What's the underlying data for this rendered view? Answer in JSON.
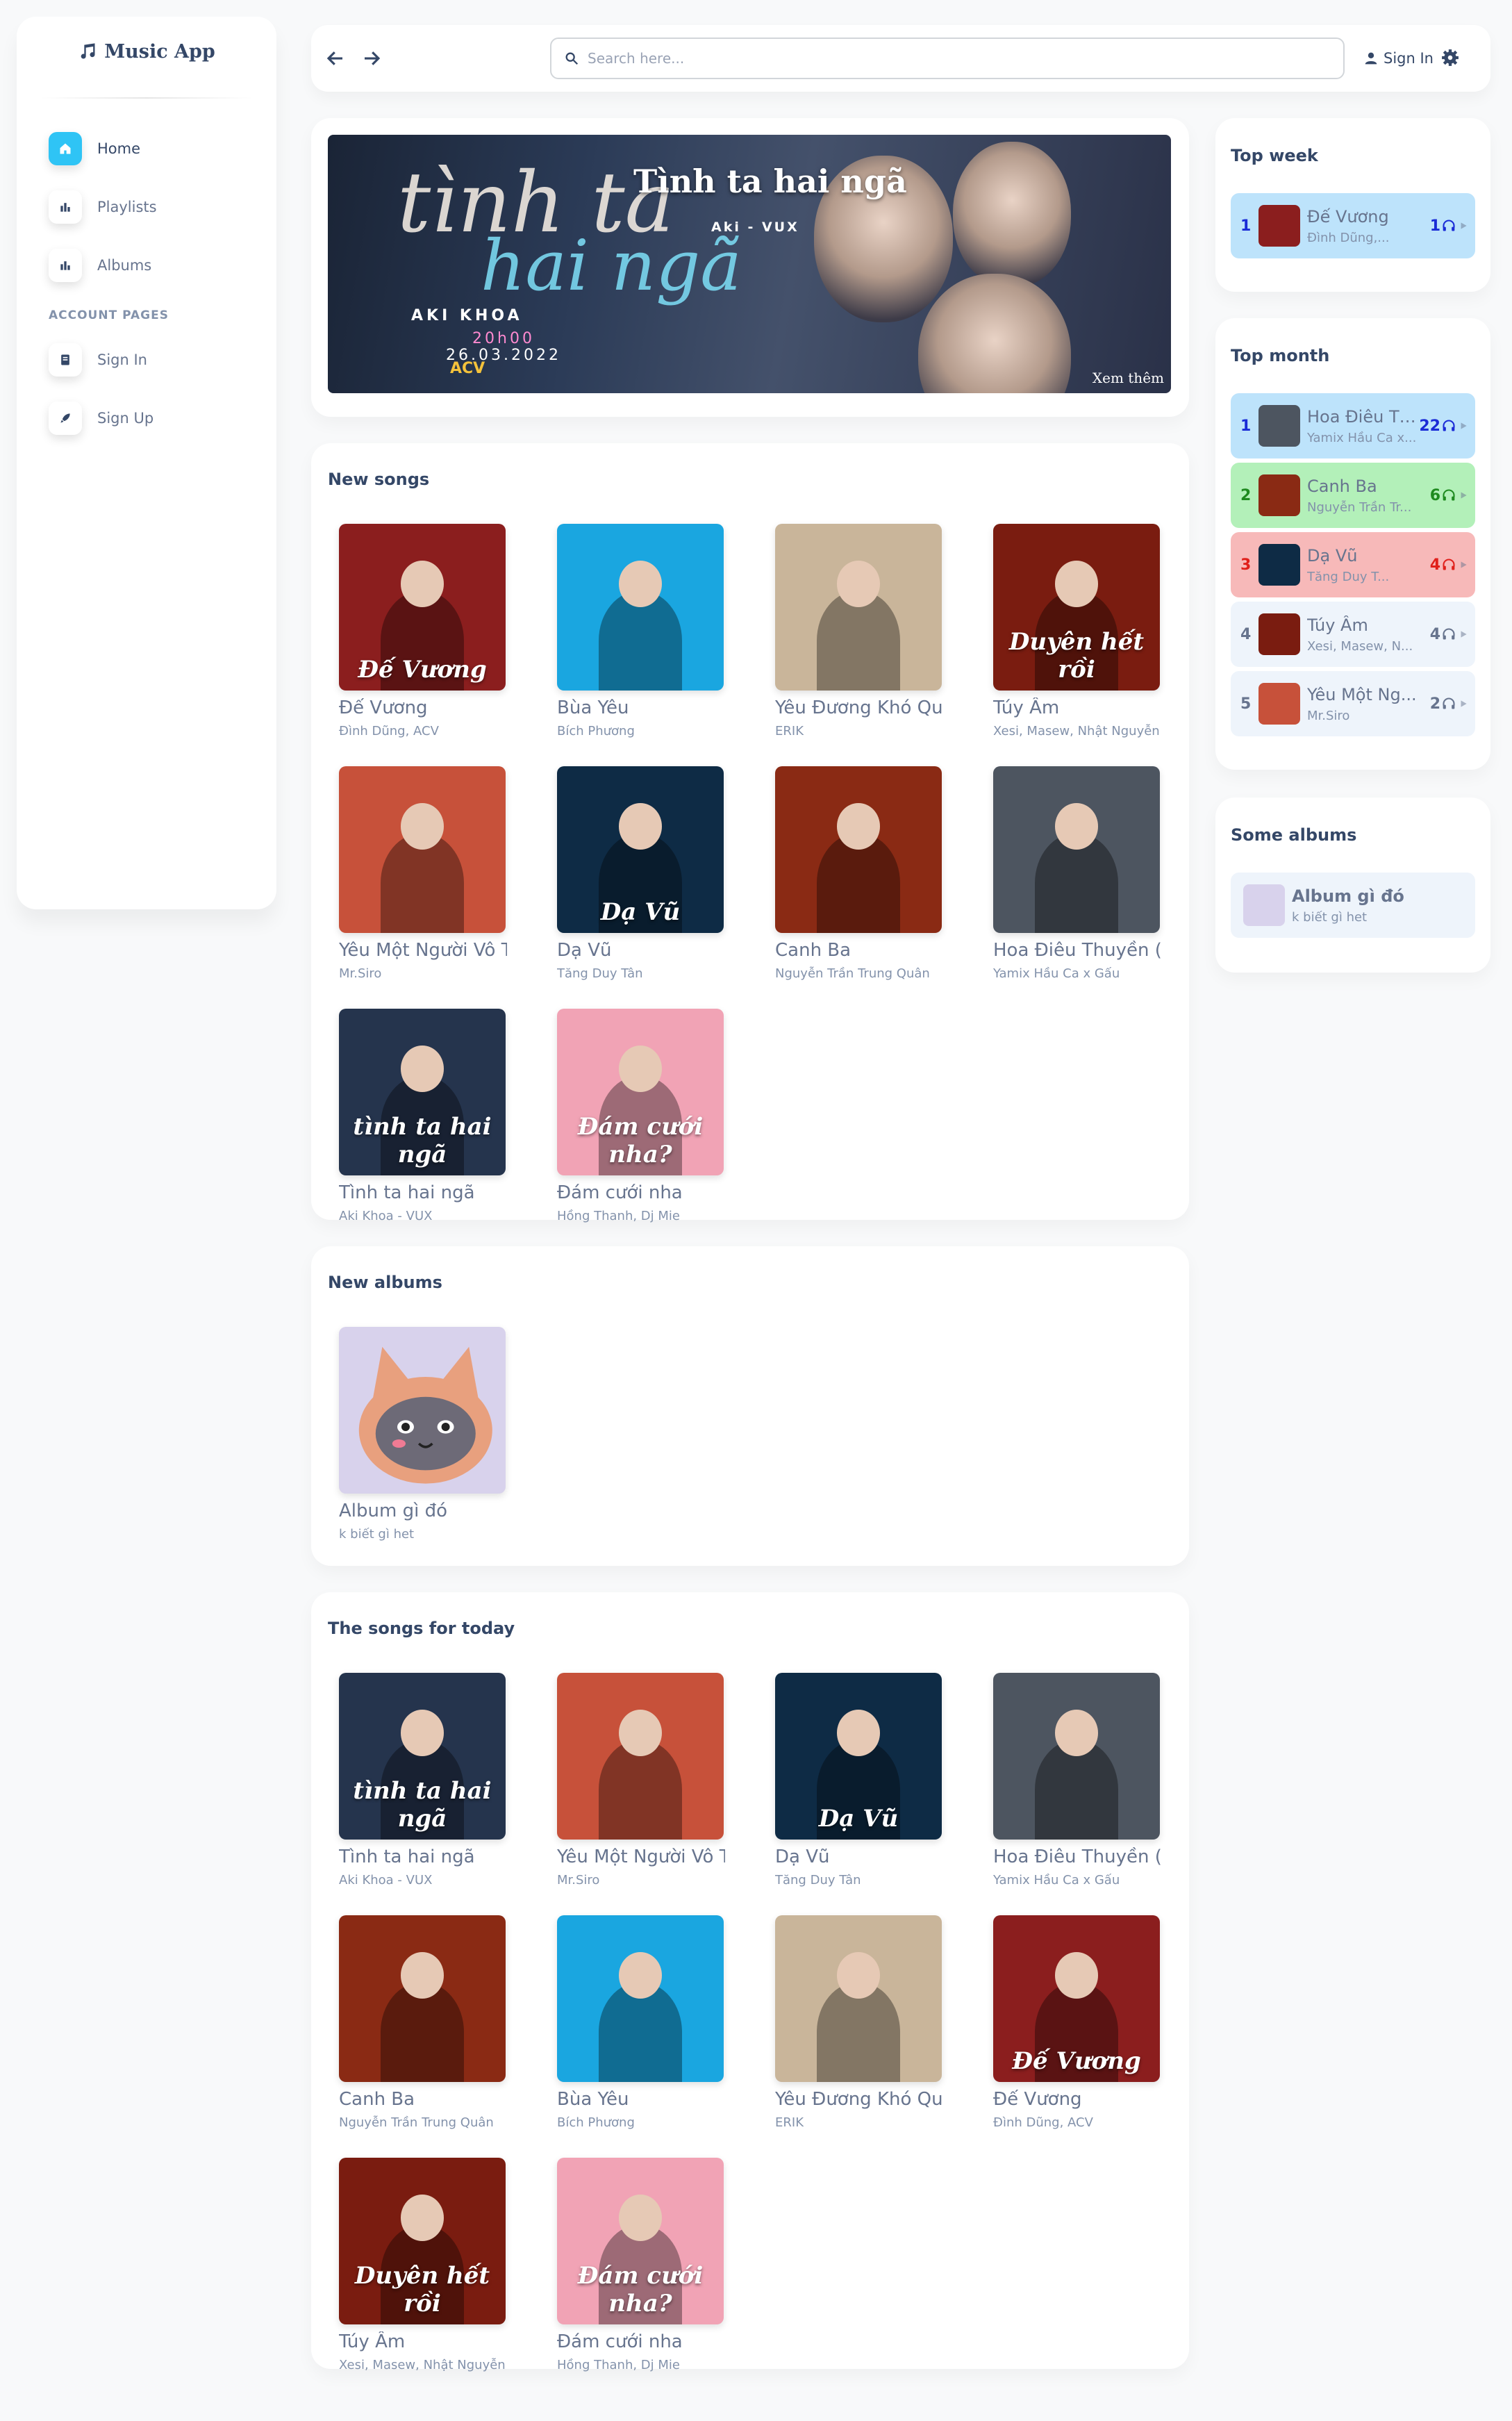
{
  "app": {
    "brand": "Music App"
  },
  "sidebar": {
    "items": [
      {
        "label": "Home",
        "icon": "home-icon",
        "active": true
      },
      {
        "label": "Playlists",
        "icon": "chart-bar-icon"
      },
      {
        "label": "Albums",
        "icon": "chart-bar-icon"
      }
    ],
    "section_header": "ACCOUNT PAGES",
    "account_items": [
      {
        "label": "Sign In",
        "icon": "document-icon"
      },
      {
        "label": "Sign Up",
        "icon": "rocket-icon"
      }
    ]
  },
  "topbar": {
    "search_placeholder": "Search here...",
    "sign_in": "Sign In"
  },
  "banner": {
    "title": "Tình ta hai ngã",
    "subtitle": "Aki - VUX",
    "more": "Xem thêm",
    "logo_line1": "tình ta",
    "logo_line2": "hai ngã",
    "credit": "AKI KHOA",
    "time": "20h00",
    "date": "26.03.2022",
    "label": "ACV"
  },
  "new_songs": {
    "title": "New songs",
    "items": [
      {
        "name": "Đế Vương",
        "artist": "Đình Dũng, ACV",
        "cover_text": "Đế Vương",
        "bg": "#8b1e1e"
      },
      {
        "name": "Bùa Yêu",
        "artist": "Bích Phương",
        "cover_text": "",
        "bg": "#1aa6e0"
      },
      {
        "name": "Yêu Đương Khó Quá",
        "artist": "ERIK",
        "cover_text": "",
        "bg": "#c9b59a"
      },
      {
        "name": "Túy Âm",
        "artist": "Xesi, Masew, Nhật Nguyễn",
        "cover_text": "Duyên hết rồi",
        "bg": "#7a1c10"
      },
      {
        "name": "Yêu Một Người Vô Tâm",
        "artist": "Mr.Siro",
        "cover_text": "",
        "bg": "#c7513a"
      },
      {
        "name": "Dạ Vũ",
        "artist": "Tăng Duy Tân",
        "cover_text": "Dạ Vũ",
        "bg": "#0e2b45"
      },
      {
        "name": "Canh Ba",
        "artist": "Nguyễn Trần Trung Quân",
        "cover_text": "",
        "bg": "#8a2a14"
      },
      {
        "name": "Hoa Điêu Thuyền (Lofi)",
        "artist": "Yamix Hầu Ca x Gấu",
        "cover_text": "",
        "bg": "#4d5560"
      },
      {
        "name": "Tình ta hai ngã",
        "artist": "Aki Khoa - VUX",
        "cover_text": "tình ta hai ngã",
        "bg": "#25344d"
      },
      {
        "name": "Đám cưới nha",
        "artist": "Hồng Thanh, Dj Mie",
        "cover_text": "Đám cưới nha?",
        "bg": "#f1a3b5"
      }
    ]
  },
  "new_albums": {
    "title": "New albums",
    "items": [
      {
        "name": "Album gì đó",
        "artist": "k biết gì het",
        "bg": "#d8d2ec"
      }
    ]
  },
  "today": {
    "title": "The songs for today",
    "items": [
      {
        "name": "Tình ta hai ngã",
        "artist": "Aki Khoa - VUX",
        "cover_text": "tình ta hai ngã",
        "bg": "#25344d"
      },
      {
        "name": "Yêu Một Người Vô Tâm",
        "artist": "Mr.Siro",
        "cover_text": "",
        "bg": "#c7513a"
      },
      {
        "name": "Dạ Vũ",
        "artist": "Tăng Duy Tân",
        "cover_text": "Dạ Vũ",
        "bg": "#0e2b45"
      },
      {
        "name": "Hoa Điêu Thuyền (Lofi)",
        "artist": "Yamix Hầu Ca x Gấu",
        "cover_text": "",
        "bg": "#4d5560"
      },
      {
        "name": "Canh Ba",
        "artist": "Nguyễn Trần Trung Quân",
        "cover_text": "",
        "bg": "#8a2a14"
      },
      {
        "name": "Bùa Yêu",
        "artist": "Bích Phương",
        "cover_text": "",
        "bg": "#1aa6e0"
      },
      {
        "name": "Yêu Đương Khó Quá",
        "artist": "ERIK",
        "cover_text": "",
        "bg": "#c9b59a"
      },
      {
        "name": "Đế Vương",
        "artist": "Đình Dũng, ACV",
        "cover_text": "Đế Vương",
        "bg": "#8b1e1e"
      },
      {
        "name": "Túy Âm",
        "artist": "Xesi, Masew, Nhật Nguyễn",
        "cover_text": "Duyên hết rồi",
        "bg": "#7a1c10"
      },
      {
        "name": "Đám cưới nha",
        "artist": "Hồng Thanh, Dj Mie",
        "cover_text": "Đám cưới nha?",
        "bg": "#f1a3b5"
      }
    ]
  },
  "top_week": {
    "title": "Top week",
    "items": [
      {
        "rank": "1",
        "title": "Đế Vương",
        "artist": "Đình Dũng,...",
        "count": "1",
        "bg": "#bde3fb",
        "color": "#1a2bd6",
        "thumb": "#8b1e1e"
      }
    ]
  },
  "top_month": {
    "title": "Top month",
    "items": [
      {
        "rank": "1",
        "title": "Hoa Điêu Th...",
        "artist": "Yamix Hầu Ca x...",
        "count": "22",
        "bg": "#bde3fb",
        "color": "#1a2bd6",
        "thumb": "#4d5560"
      },
      {
        "rank": "2",
        "title": "Canh Ba",
        "artist": "Nguyễn Trần Tr...",
        "count": "6",
        "bg": "#b3f0b9",
        "color": "#1f8a1f",
        "thumb": "#8a2a14"
      },
      {
        "rank": "3",
        "title": "Dạ Vũ",
        "artist": "Tăng Duy T...",
        "count": "4",
        "bg": "#f7b9b9",
        "color": "#e0201b",
        "thumb": "#0e2b45"
      },
      {
        "rank": "4",
        "title": "Túy Âm",
        "artist": "Xesi, Masew, N...",
        "count": "4",
        "bg": "#eef4fb",
        "color": "#67748e",
        "thumb": "#7a1c10"
      },
      {
        "rank": "5",
        "title": "Yêu Một Ng...",
        "artist": "Mr.Siro",
        "count": "2",
        "bg": "#eef4fb",
        "color": "#67748e",
        "thumb": "#c7513a"
      }
    ]
  },
  "some_albums": {
    "title": "Some albums",
    "items": [
      {
        "title": "Album gì đó",
        "artist": "k biết gì het",
        "bg": "#eef4fb",
        "thumb": "#d8d2ec"
      }
    ]
  }
}
